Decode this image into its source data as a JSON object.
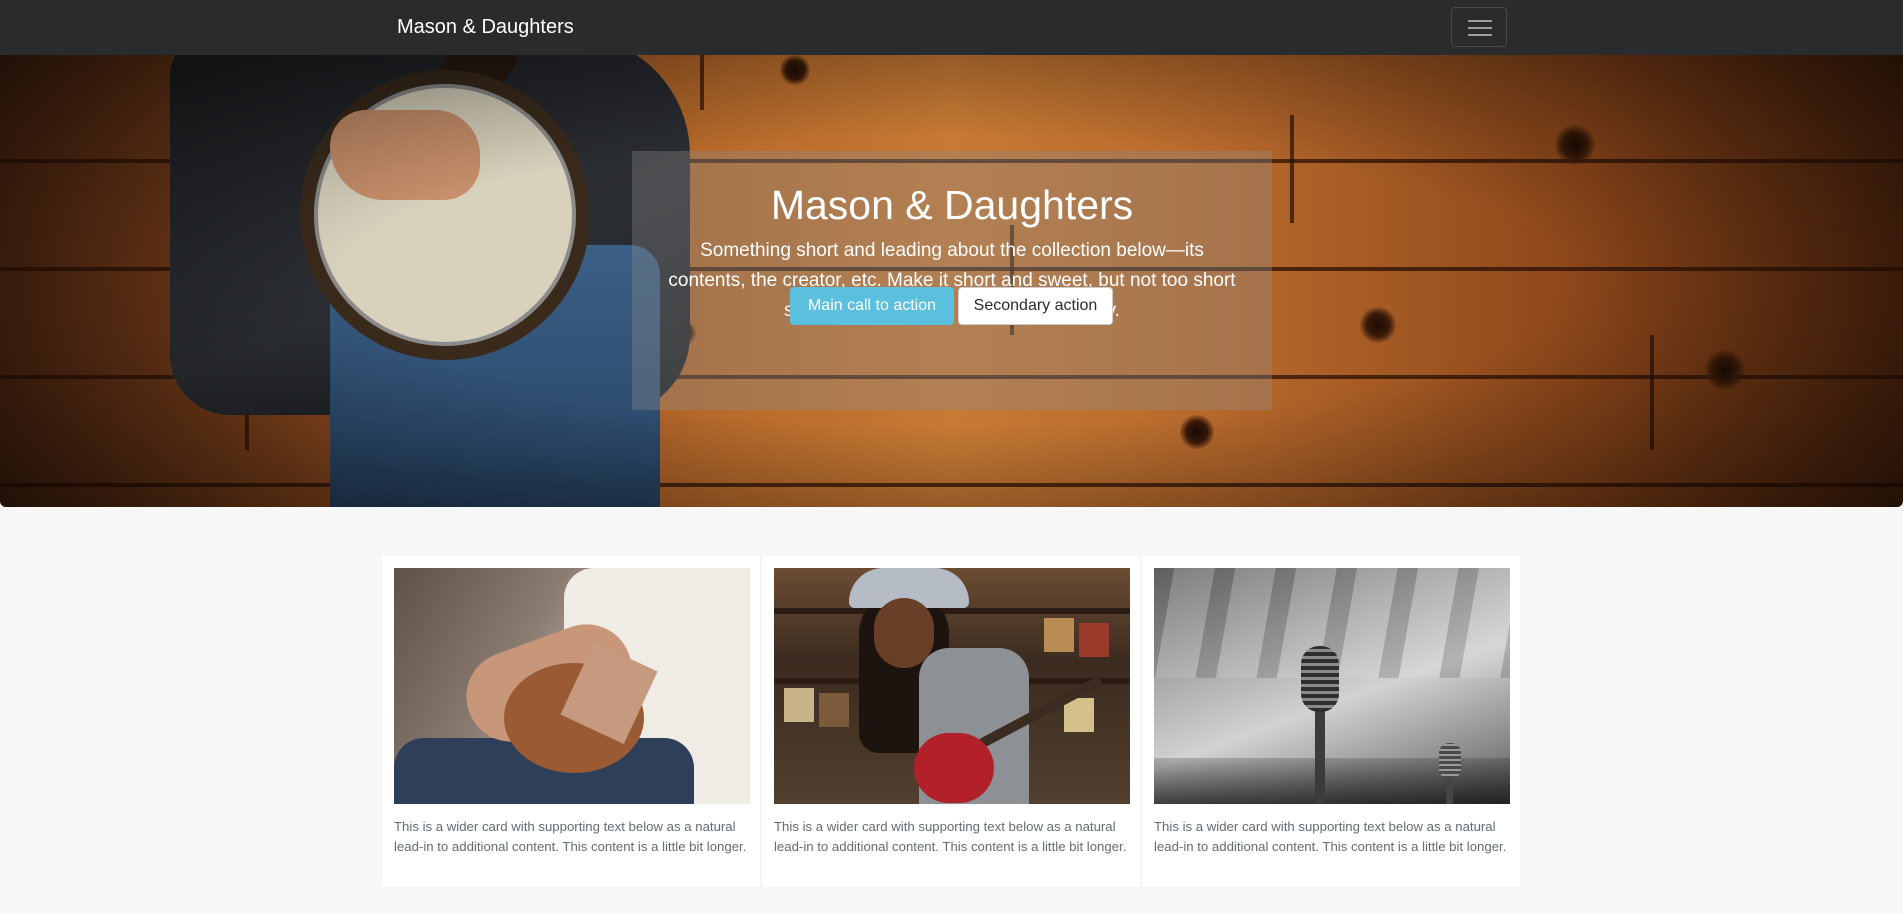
{
  "navbar": {
    "brand": "Mason & Daughters",
    "toggler_icon": "hamburger-menu-icon"
  },
  "hero": {
    "title": "Mason & Daughters",
    "lead": "Something short and leading about the collection below—its contents, the creator, etc. Make it short and sweet, but not too short so folks don't simply skip over it entirely.",
    "primary_button": "Main call to action",
    "secondary_button": "Secondary action",
    "image": "banjo-player-on-wood-wall"
  },
  "cards": [
    {
      "image": "guitarist-closeup",
      "text": "This is a wider card with supporting text below as a natural lead-in to additional content. This content is a little bit longer."
    },
    {
      "image": "woman-with-red-guitar",
      "text": "This is a wider card with supporting text below as a natural lead-in to additional content. This content is a little bit longer."
    },
    {
      "image": "vintage-microphone",
      "text": "This is a wider card with supporting text below as a natural lead-in to additional content. This content is a little bit longer."
    }
  ],
  "colors": {
    "navbar_bg": "#292b2c",
    "primary": "#5bc0de",
    "page_bg": "#f7f7f7",
    "card_text": "#636c72"
  }
}
